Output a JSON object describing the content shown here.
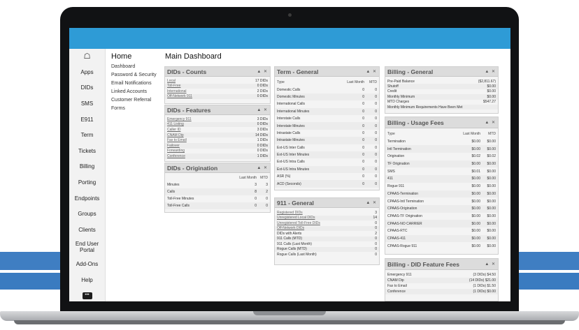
{
  "nav": {
    "items": [
      "Apps",
      "DIDs",
      "SMS",
      "E911",
      "Term",
      "Tickets",
      "Billing",
      "Porting",
      "Endpoints",
      "Groups",
      "Clients",
      "End User Portal",
      "Add-Ons",
      "Help"
    ]
  },
  "submenu": {
    "title": "Home",
    "links": [
      "Dashboard",
      "Password & Security",
      "Email Notifications",
      "Linked Accounts",
      "Customer Referral",
      "Forms"
    ]
  },
  "main": {
    "title": "Main Dashboard"
  },
  "panels": {
    "dids_counts": {
      "title": "DIDs - Counts",
      "controls": "▲ ✕",
      "rows": [
        [
          "Local",
          "17 DIDs"
        ],
        [
          "Toll-Free",
          "0 DIDs"
        ],
        [
          "International",
          "2 DIDs"
        ],
        [
          "Off-Network 911",
          "0 DIDs"
        ]
      ]
    },
    "dids_features": {
      "title": "DIDs - Features",
      "controls": "▲ ✕",
      "rows": [
        [
          "Emergency 911",
          "3 DIDs"
        ],
        [
          "411 Listing",
          "0 DIDs"
        ],
        [
          "Caller ID",
          "3 DIDs"
        ],
        [
          "CNAM Dip",
          "14 DIDs"
        ],
        [
          "Fax to Email",
          "1 DIDs"
        ],
        [
          "Failover",
          "0 DIDs"
        ],
        [
          "Forwarding",
          "0 DIDs"
        ],
        [
          "Conference",
          "1 DIDs"
        ]
      ]
    },
    "dids_origination": {
      "title": "DIDs - Origination",
      "controls": "▲ ✕",
      "headers": [
        "",
        "Last Month",
        "MTD"
      ],
      "rows": [
        [
          "Minutes",
          "3",
          "3"
        ],
        [
          "Calls",
          "8",
          "2"
        ],
        [
          "Toll-Free Minutes",
          "0",
          "0"
        ],
        [
          "Toll-Free Calls",
          "0",
          "0"
        ]
      ]
    },
    "term_general": {
      "title": "Term - General",
      "controls": "▲ ✕",
      "headers": [
        "Type",
        "Last Month",
        "MTD"
      ],
      "rows": [
        [
          "Domestic Calls",
          "0",
          "0"
        ],
        [
          "Domestic Minutes",
          "0",
          "0"
        ],
        [
          "International Calls",
          "0",
          "0"
        ],
        [
          "International Minutes",
          "0",
          "0"
        ],
        [
          "Interstate Calls",
          "0",
          "0"
        ],
        [
          "Interstate Minutes",
          "0",
          "0"
        ],
        [
          "Intrastate Calls",
          "0",
          "0"
        ],
        [
          "Intrastate Minutes",
          "0",
          "0"
        ],
        [
          "Ext-US Inter Calls",
          "0",
          "0"
        ],
        [
          "Ext-US Inter Minutes",
          "0",
          "0"
        ],
        [
          "Ext-US Intra Calls",
          "0",
          "0"
        ],
        [
          "Ext-US Intra Minutes",
          "0",
          "0"
        ],
        [
          "ASR (%)",
          "0",
          "0"
        ],
        [
          "ACD (Seconds)",
          "0",
          "0"
        ]
      ]
    },
    "general_911": {
      "title": "911 - General",
      "controls": "▲ ✕",
      "rows": [
        [
          "Registered DIDs",
          "3",
          true
        ],
        [
          "Unregistered Local DIDs",
          "14",
          true
        ],
        [
          "Unregistered Toll-Free DIDs",
          "0",
          true
        ],
        [
          "Off-Network DIDs",
          "0",
          true
        ],
        [
          "DIDs with Alerts",
          "2",
          false
        ],
        [
          "911 Calls (MTD)",
          "0",
          false
        ],
        [
          "911 Calls (Last Month)",
          "0",
          false
        ],
        [
          "Rogue Calls (MTD)",
          "0",
          false
        ],
        [
          "Rogue Calls (Last Month)",
          "0",
          false
        ]
      ]
    },
    "billing_general": {
      "title": "Billing - General",
      "controls": "▲ ✕",
      "rows": [
        [
          "Pre-Paid Balance",
          "($2,811.67)"
        ],
        [
          "Shutoff",
          "$0.00"
        ],
        [
          "Credit",
          "$0.00"
        ],
        [
          "Monthly Minimum",
          "$0.00"
        ],
        [
          "MTD Charges",
          "$547.27"
        ],
        [
          "Monthly Minimum Requirements Have Been Met",
          ""
        ]
      ]
    },
    "billing_usage": {
      "title": "Billing - Usage Fees",
      "controls": "▲ ✕",
      "headers": [
        "Type",
        "Last Month",
        "MTD"
      ],
      "rows": [
        [
          "Termination",
          "$0.00",
          "$0.00"
        ],
        [
          "Intl Termination",
          "$0.00",
          "$0.00"
        ],
        [
          "Origination",
          "$0.02",
          "$0.02"
        ],
        [
          "TF Origination",
          "$0.00",
          "$0.00"
        ],
        [
          "SMS",
          "$0.01",
          "$0.00"
        ],
        [
          "411",
          "$0.00",
          "$0.00"
        ],
        [
          "Rogue 911",
          "$0.00",
          "$0.00"
        ],
        [
          "CPAAS-Termination",
          "$0.00",
          "$0.00"
        ],
        [
          "CPAAS-Intl Termination",
          "$0.00",
          "$0.00"
        ],
        [
          "CPAAS-Origination",
          "$0.00",
          "$0.00"
        ],
        [
          "CPAAS-TF Origination",
          "$0.00",
          "$0.00"
        ],
        [
          "CPAAS-NO CARRIER",
          "$0.00",
          "$0.00"
        ],
        [
          "CPAAS-RTC",
          "$0.00",
          "$0.00"
        ],
        [
          "CPAAS-411",
          "$0.00",
          "$0.00"
        ],
        [
          "CPAAS-Rogue 911",
          "$0.00",
          "$0.00"
        ]
      ]
    },
    "billing_did_features": {
      "title": "Billing - DID Feature Fees",
      "controls": "▲ ✕",
      "rows": [
        [
          "Emergency 911",
          "(3 DIDs) $4.50"
        ],
        [
          "CNAM Dip",
          "(14 DIDs) $21.00"
        ],
        [
          "Fax to Email",
          "(1 DIDs) $1.50"
        ],
        [
          "Conference",
          "(1 DIDs) $0.00"
        ]
      ]
    }
  },
  "colors": {
    "topbar": "#2e9bd6",
    "band": "#3f7ec2",
    "bezel": "#111214"
  },
  "icons": {
    "home": "home-icon",
    "chat": "chat-icon"
  }
}
